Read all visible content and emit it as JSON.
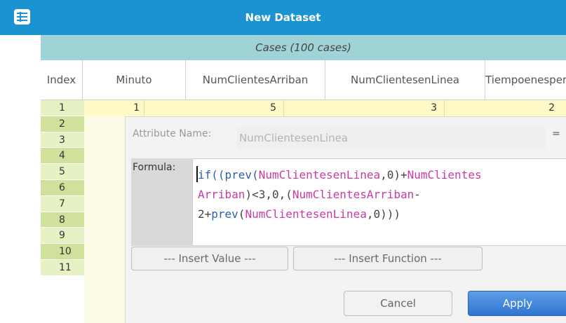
{
  "window": {
    "title": "New Dataset"
  },
  "table": {
    "caption": "Cases (100 cases)",
    "columns": [
      "Index",
      "Minuto",
      "NumClientesArriban",
      "NumClientesenLinea",
      "Tiempoenespera"
    ],
    "row_indices": [
      "1",
      "2",
      "3",
      "4",
      "5",
      "6",
      "7",
      "8",
      "9",
      "10",
      "11"
    ],
    "first_row": {
      "minuto": "1",
      "arriban": "5",
      "linea": "3",
      "tiempo": "2"
    }
  },
  "dialog": {
    "attribute_label": "Attribute Name:",
    "attribute_value": "NumClientesenLinea",
    "equals": "=",
    "formula_label": "Formula:",
    "formula": {
      "line1": {
        "t1": "if((",
        "t2": "prev",
        "t3": "(",
        "t4": "NumClientesenLinea",
        "t5": ",0)+",
        "t6": "NumClientes"
      },
      "line2": {
        "t1": "Arriban",
        "t2": ")<3,0,(",
        "t3": "NumClientesArriban",
        "t4": "-"
      },
      "line3": {
        "t1": "2+",
        "t2": "prev",
        "t3": "(",
        "t4": "NumClientesenLinea",
        "t5": ",0)))"
      }
    },
    "insert_value": "--- Insert Value ---",
    "insert_function": "--- Insert Function ---",
    "cancel": "Cancel",
    "apply": "Apply"
  },
  "colors": {
    "title_bar": "#1b93d1",
    "cases_bar": "#9fd3d5",
    "index_light": "#e6f1c4",
    "index_dark": "#cfe19b",
    "cell_yellow": "#fff9c8",
    "formula_function": "#2d5fb0",
    "formula_attribute": "#c93aa5",
    "apply_button": "#2f75d1"
  },
  "icons": {
    "title_icon": "table-icon"
  }
}
